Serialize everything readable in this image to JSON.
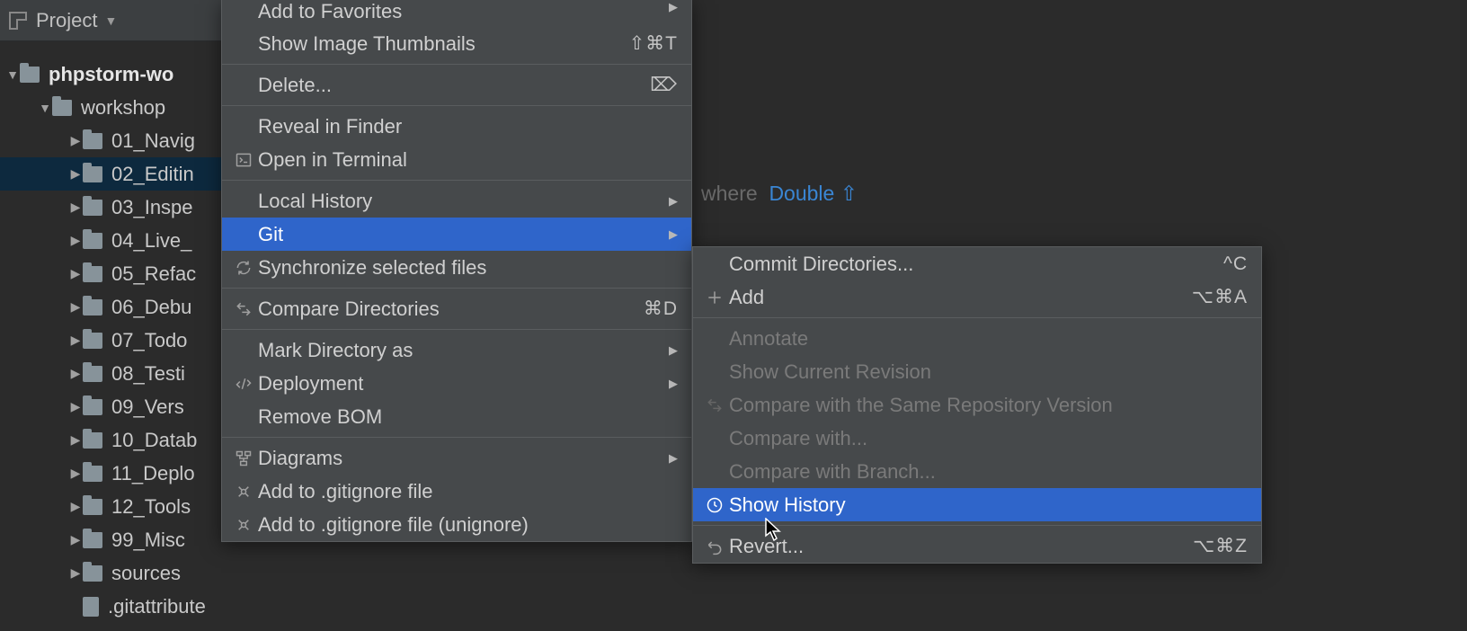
{
  "projectLabel": "Project",
  "tree": {
    "root": "phpstorm-wo",
    "rootChild": "workshop",
    "items": [
      "01_Navig",
      "02_Editin",
      "03_Inspe",
      "04_Live_",
      "05_Refac",
      "06_Debu",
      "07_Todo",
      "08_Testi",
      "09_Vers",
      "10_Datab",
      "11_Deplo",
      "12_Tools",
      "99_Misc"
    ],
    "sources": "sources",
    "gitattr": ".gitattribute"
  },
  "hint": {
    "text": "where",
    "key": "Double ⇧"
  },
  "menu1": {
    "addFavorites": "Add to Favorites",
    "showThumbnails": "Show Image Thumbnails",
    "showThumbnailsKey": "⇧⌘T",
    "delete": "Delete...",
    "reveal": "Reveal in Finder",
    "openTerminal": "Open in Terminal",
    "localHistory": "Local History",
    "git": "Git",
    "sync": "Synchronize selected files",
    "compareDirs": "Compare Directories",
    "compareDirsKey": "⌘D",
    "markDir": "Mark Directory as",
    "deployment": "Deployment",
    "removeBom": "Remove BOM",
    "diagrams": "Diagrams",
    "addGitignore": "Add to .gitignore file",
    "addGitignoreUn": "Add to .gitignore file (unignore)"
  },
  "menu2": {
    "commit": "Commit Directories...",
    "commitKey": "^C",
    "add": "Add",
    "addKey": "⌥⌘A",
    "annotate": "Annotate",
    "showRev": "Show Current Revision",
    "compareSame": "Compare with the Same Repository Version",
    "compareWith": "Compare with...",
    "compareBranch": "Compare with Branch...",
    "showHistory": "Show History",
    "revert": "Revert...",
    "revertKey": "⌥⌘Z"
  }
}
